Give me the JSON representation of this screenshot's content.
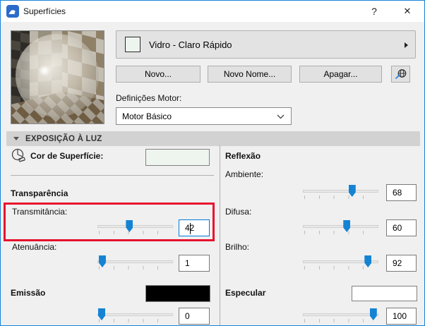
{
  "window": {
    "title": "Superfícies",
    "help_glyph": "?",
    "close_glyph": "✕"
  },
  "material_selector": {
    "name": "Vidro - Claro Rápido",
    "swatch_color": "#eef5ef"
  },
  "buttons": {
    "new": "Novo...",
    "rename": "Novo Nome...",
    "delete": "Apagar...",
    "globe_icon": "globe-download-icon"
  },
  "engine": {
    "label": "Definições Motor:",
    "value": "Motor Básico"
  },
  "section": {
    "title": "EXPOSIÇÃO À LUZ"
  },
  "surface_color": {
    "label": "Cor de Superfície:",
    "swatch_color": "#eef5ef"
  },
  "left_column": {
    "transparency_title": "Transparência",
    "transmittance": {
      "label": "Transmitância:",
      "value": "42",
      "percent": 42
    },
    "attenuation": {
      "label": "Atenuância:",
      "value": "1",
      "percent": 1
    },
    "emission_title": "Emissão",
    "emission": {
      "value": "0",
      "percent": 0,
      "swatch_color": "#000000"
    }
  },
  "right_column": {
    "reflection_title": "Reflexão",
    "ambient": {
      "label": "Ambiente:",
      "value": "68",
      "percent": 68
    },
    "diffuse": {
      "label": "Difusa:",
      "value": "60",
      "percent": 60
    },
    "shine": {
      "label": "Brilho:",
      "value": "92",
      "percent": 92
    },
    "specular_title": "Especular",
    "specular": {
      "value": "100",
      "percent": 100,
      "swatch_color": "#ffffff"
    }
  },
  "colors": {
    "window_border": "#1883d7",
    "accent_focus": "#0078d7",
    "slider_thumb": "#1583d3",
    "annotation_red": "#e8112d",
    "section_header_bg": "#d2d2d2"
  }
}
